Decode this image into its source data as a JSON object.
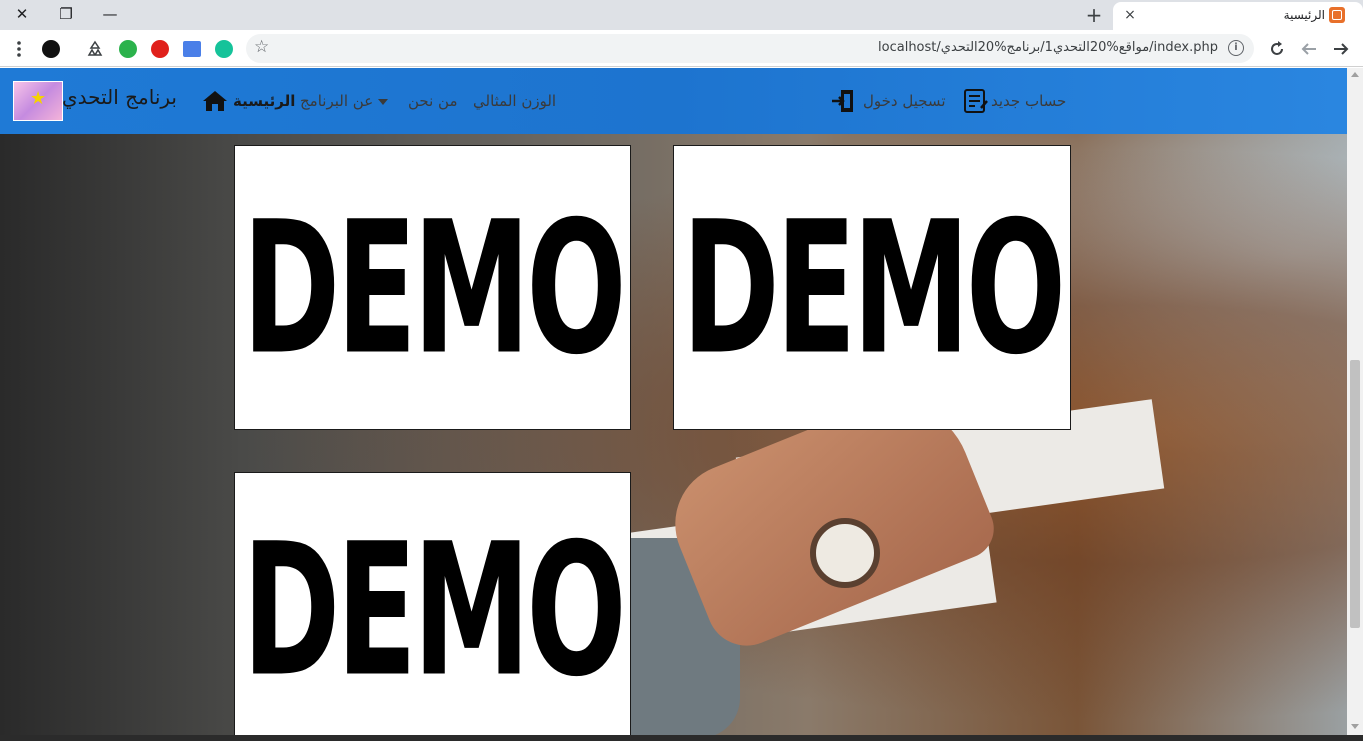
{
  "browser": {
    "tab_title": "الرئيسية",
    "tab_close": "×",
    "new_tab": "+",
    "url": "localhost/مواقع%20التحدي1/برنامج%20التحدي/index.php",
    "info_icon": "i",
    "window_controls": {
      "close": "✕",
      "restore": "❐",
      "minimize": "—"
    }
  },
  "navbar": {
    "brand": "برنامج التحدي",
    "links": {
      "home": "الرئيسية",
      "about_program": "عن البرنامج",
      "about_us": "من نحن",
      "ideal_weight": "الوزن المثالي",
      "sign_in": "تسجيل دخول",
      "register": "حساب جديد"
    },
    "color": "#1d74cf"
  },
  "content": {
    "images": [
      {
        "label": "DEMO"
      },
      {
        "label": "DEMO"
      },
      {
        "label": "DEMO"
      }
    ]
  }
}
